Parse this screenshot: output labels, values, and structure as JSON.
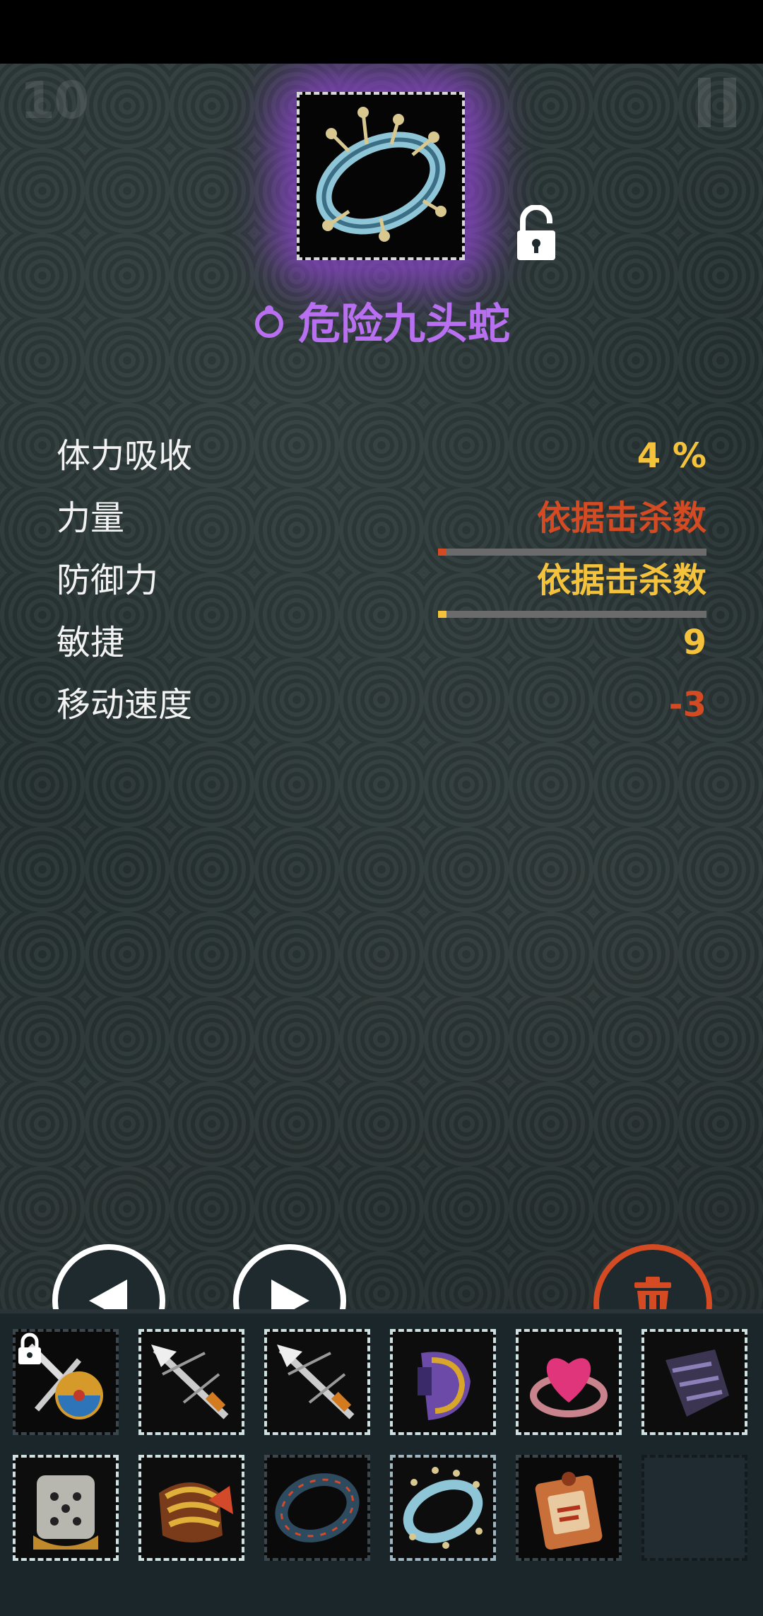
{
  "hud": {
    "level": "10"
  },
  "item": {
    "name": "危险九头蛇",
    "rarity_color": "#b86ff0",
    "icon": "ring-icon",
    "locked": false
  },
  "stats": [
    {
      "label": "体力吸收",
      "value": "4 %",
      "color": "#f5c23b",
      "bar": null
    },
    {
      "label": "力量",
      "value": "依据击杀数",
      "color": "#d34a23",
      "bar": {
        "fraction": 0.01,
        "color": "#d34a23"
      }
    },
    {
      "label": "防御力",
      "value": "依据击杀数",
      "color": "#f5c23b",
      "bar": {
        "fraction": 0.03,
        "color": "#f5c23b"
      }
    },
    {
      "label": "敏捷",
      "value": "9",
      "color": "#f5c23b",
      "bar": null
    },
    {
      "label": "移动速度",
      "value": "-3",
      "color": "#d34a23",
      "bar": null
    }
  ],
  "controls": {
    "prev": "prev-arrow-icon",
    "next": "next-arrow-icon",
    "delete": "trash-icon"
  },
  "inventory": [
    {
      "icon": "sword-shield-icon",
      "locked": true,
      "selected": false
    },
    {
      "icon": "arrow-icon",
      "locked": false,
      "selected": false
    },
    {
      "icon": "arrow-icon",
      "locked": false,
      "selected": false
    },
    {
      "icon": "purple-bracer-icon",
      "locked": false,
      "selected": false
    },
    {
      "icon": "heart-ring-icon",
      "locked": false,
      "selected": false
    },
    {
      "icon": "dark-gauntlet-icon",
      "locked": false,
      "selected": false
    },
    {
      "icon": "stone-dice-icon",
      "locked": false,
      "selected": false
    },
    {
      "icon": "gold-bracer-icon",
      "locked": false,
      "selected": false
    },
    {
      "icon": "dark-ring-icon",
      "locked": false,
      "selected": false
    },
    {
      "icon": "ring-icon",
      "locked": false,
      "selected": true
    },
    {
      "icon": "scroll-tag-icon",
      "locked": false,
      "selected": false
    },
    {
      "icon": "empty-slot",
      "locked": false,
      "selected": false
    }
  ]
}
